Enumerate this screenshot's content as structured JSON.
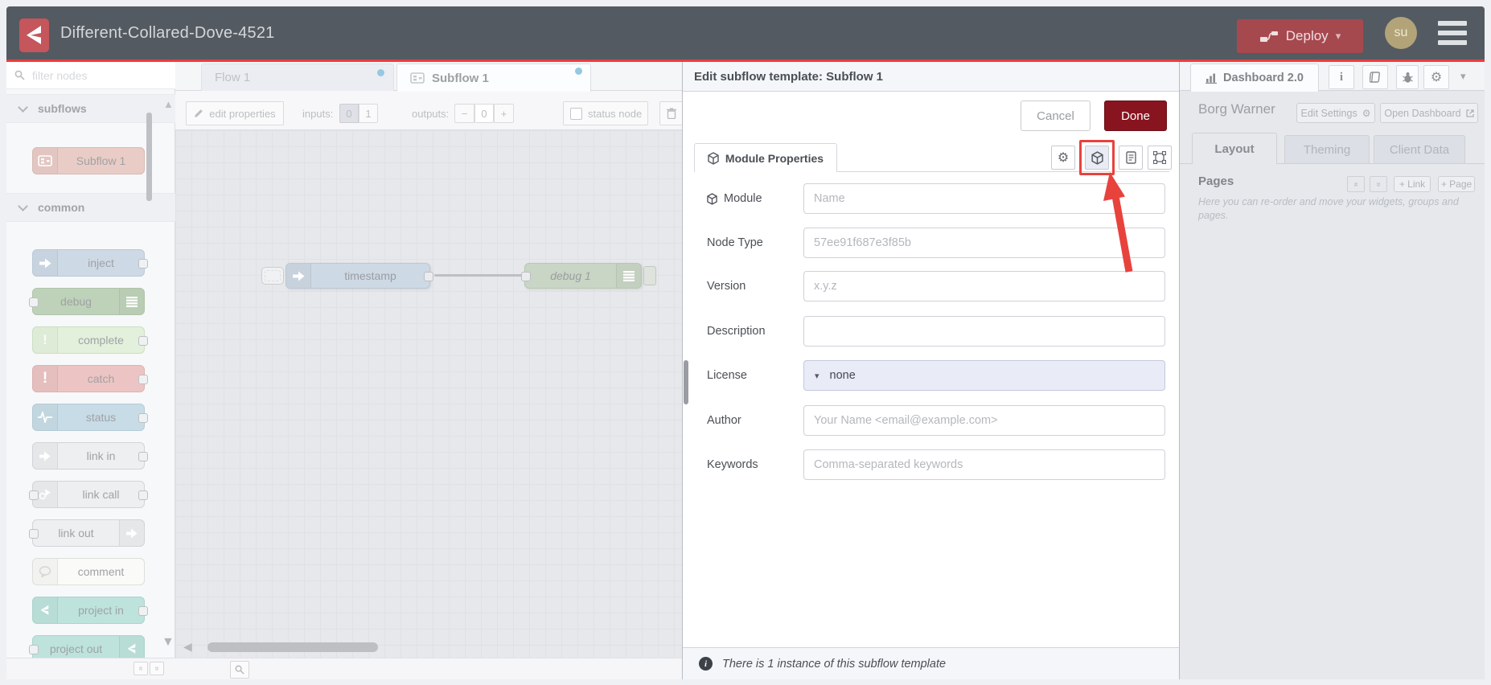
{
  "header": {
    "title": "Different-Collared-Dove-4521",
    "deploy_label": "Deploy",
    "avatar": "su"
  },
  "palette": {
    "filter_placeholder": "filter nodes",
    "sections": [
      {
        "label": "subflows",
        "nodes": [
          {
            "label": "Subflow 1"
          }
        ]
      },
      {
        "label": "common",
        "nodes": [
          {
            "label": "inject"
          },
          {
            "label": "debug"
          },
          {
            "label": "complete"
          },
          {
            "label": "catch"
          },
          {
            "label": "status"
          },
          {
            "label": "link in"
          },
          {
            "label": "link call"
          },
          {
            "label": "link out"
          },
          {
            "label": "comment"
          },
          {
            "label": "project in"
          },
          {
            "label": "project out"
          }
        ]
      }
    ]
  },
  "workspace": {
    "tabs": [
      {
        "label": "Flow 1"
      },
      {
        "label": "Subflow 1"
      }
    ],
    "toolbar": {
      "edit_properties": "edit properties",
      "inputs_label": "inputs:",
      "input_zero": "0",
      "input_one": "1",
      "outputs_label": "outputs:",
      "minus": "−",
      "output_count": "0",
      "plus": "+",
      "status_node": "status node"
    },
    "nodes": [
      {
        "label": "timestamp"
      },
      {
        "label": "debug 1"
      }
    ]
  },
  "dialog": {
    "title": "Edit subflow template: Subflow 1",
    "cancel": "Cancel",
    "done": "Done",
    "tab": "Module Properties",
    "fields": [
      {
        "label": "Module",
        "placeholder": "Name"
      },
      {
        "label": "Node Type",
        "placeholder": "57ee91f687e3f85b"
      },
      {
        "label": "Version",
        "placeholder": "x.y.z"
      },
      {
        "label": "Description",
        "placeholder": ""
      },
      {
        "label": "License",
        "value": "none"
      },
      {
        "label": "Author",
        "placeholder": "Your Name <email@example.com>"
      },
      {
        "label": "Keywords",
        "placeholder": "Comma-separated keywords"
      }
    ],
    "footer": "There is 1 instance of this subflow template"
  },
  "sidebar": {
    "tab": "Dashboard 2.0",
    "project_name": "Borg Warner",
    "edit_settings": "Edit Settings",
    "open_dashboard": "Open Dashboard",
    "tabs": [
      {
        "label": "Layout"
      },
      {
        "label": "Theming"
      },
      {
        "label": "Client Data"
      }
    ],
    "pages": {
      "title": "Pages",
      "link": "+ Link",
      "page": "+ Page",
      "help": "Here you can re-order and move your widgets, groups and pages."
    }
  },
  "icons": {
    "caret_down": "▾",
    "scroll_up": "▲",
    "scroll_down": "▼",
    "scroll_left": "◀",
    "double_left": "«",
    "double_right": "»",
    "gear": "⚙",
    "info_glyph": "i"
  },
  "colors": {
    "header_bg": "#545a61",
    "brand_red": "#c4565c",
    "alert_line": "#ee3c3c",
    "deploy_bg": "#a6494f",
    "done_bg": "#88141f",
    "annotation_red": "#e8423d",
    "tab_dot": "#4ba3cc",
    "node_inject": "#a9bed2",
    "node_debug": "#8fb187",
    "node_complete": "#cfe6c2",
    "node_catch": "#e09999",
    "node_status": "#9fc3d4",
    "node_link": "#e2e3e6",
    "node_comment": "#f7f7f3",
    "node_project": "#8ecfc3",
    "node_subflow": "#dba89d",
    "node_timestamp": "#a9bed2"
  }
}
